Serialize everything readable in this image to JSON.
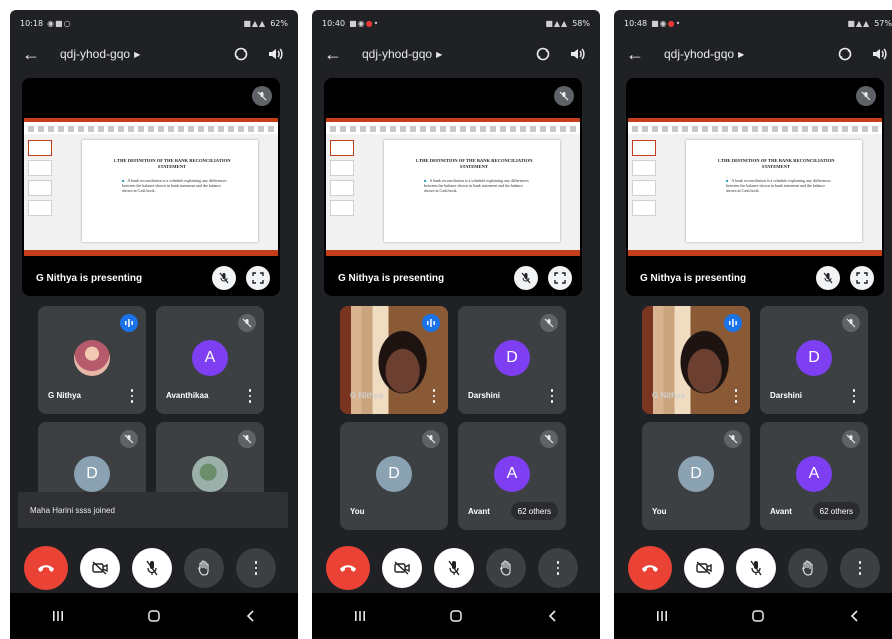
{
  "screens": [
    {
      "status_time": "10:18",
      "status_right": "62%",
      "meeting_code": "qdj-yhod-gqo",
      "presenting_label": "G Nithya is presenting",
      "slide_title": "1.THE DEFINITION OF THE BANK RECONCILIATION STATEMENT",
      "slide_bullet": "A bank reconciliation is a schedule explaining any differences between the balance shown in bank statement and the balance shown in Cash book.",
      "tiles": [
        {
          "name": "G Nithya",
          "avatar": "",
          "kind": "photo"
        },
        {
          "name": "Avanthikaa",
          "avatar": "A",
          "kind": "letter"
        },
        {
          "name": "",
          "avatar": "D",
          "kind": "letter"
        },
        {
          "name": "",
          "avatar": "",
          "kind": "photo2"
        }
      ],
      "toast": "Maha Harini ssss joined"
    },
    {
      "status_time": "10:40",
      "status_right": "58%",
      "meeting_code": "qdj-yhod-gqo",
      "presenting_label": "G Nithya is presenting",
      "slide_title": "1.THE DEFINITION OF THE BANK RECONCILIATION STATEMENT",
      "slide_bullet": "A bank reconciliation is a schedule explaining any differences between the balance shown in bank statement and the balance shown in Cash book.",
      "tiles": [
        {
          "name": "G Nithya",
          "avatar": "",
          "kind": "video"
        },
        {
          "name": "Darshini",
          "avatar": "D",
          "kind": "letter"
        },
        {
          "name": "You",
          "avatar": "D",
          "kind": "letter"
        },
        {
          "name": "Avant",
          "avatar": "A",
          "kind": "letter",
          "others": "62 others"
        }
      ]
    },
    {
      "status_time": "10:48",
      "status_right": "57%",
      "meeting_code": "qdj-yhod-gqo",
      "presenting_label": "G Nithya is presenting",
      "slide_title": "1.THE DEFINITION OF THE BANK RECONCILIATION STATEMENT",
      "slide_bullet": "A bank reconciliation is a schedule explaining any differences between the balance shown in bank statement and the balance shown in Cash book.",
      "tiles": [
        {
          "name": "G Nithya",
          "avatar": "",
          "kind": "video"
        },
        {
          "name": "Darshini",
          "avatar": "D",
          "kind": "letter"
        },
        {
          "name": "You",
          "avatar": "D",
          "kind": "letter"
        },
        {
          "name": "Avant",
          "avatar": "A",
          "kind": "letter",
          "others": "62 others"
        }
      ]
    }
  ],
  "colors": {
    "background": "#202124",
    "tile": "#3c4043",
    "hangup": "#ea4335",
    "avatar_purple": "#7e3ff2",
    "avatar_grey": "#8ba2b2",
    "audio_indicator": "#1a73e8"
  },
  "icons": {
    "back": "back-arrow-icon",
    "switch_camera": "switch-camera-icon",
    "speaker": "speaker-icon",
    "mic_off": "mic-off-icon",
    "fullscreen": "fullscreen-icon",
    "hang_up": "hang-up-icon",
    "camera_off": "camera-off-icon",
    "raise_hand": "raise-hand-icon",
    "more": "more-vert-icon"
  }
}
